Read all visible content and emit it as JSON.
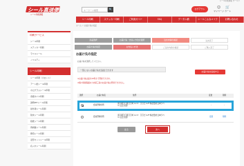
{
  "header": {
    "top_note": "シール印刷通販 ワールド",
    "logo_text": "シール直送便",
    "logo_sub": "シール印刷通販",
    "search_placeholder": "キーワード検索",
    "search_button": "🔍",
    "login_label": "ログアウト",
    "mypage_label": "マイページ",
    "cart_label": "カート"
  },
  "nav": {
    "items": [
      "シール印刷",
      "ステッカー印刷",
      "ご利用ガイド",
      "FAQ",
      "データ入稿",
      "シールこんなメイク",
      "お問い合わせ"
    ]
  },
  "breadcrumb": "ホーム ＞ お届け先の指定",
  "sidebar": {
    "section1_title": "印刷サービス",
    "section1_items": [
      "シール印刷",
      "ステッカー印刷",
      "ラベルシール",
      "ノベルティ"
    ],
    "section2_title": "シール印刷",
    "section2_items": [
      "シール印刷（小ロット）",
      "アート紙シール印刷",
      "ホログラムシール印刷",
      "金銀ホイル印刷",
      "透明PETシール印刷",
      "屋外用シール印刷",
      "耐水シール印刷",
      "和紙シール印刷",
      "再剥離シール印刷",
      "発泡シール印刷",
      "変形カットシール印刷",
      "名入れシール印刷"
    ]
  },
  "steps": {
    "items": [
      "商品選択",
      "お届け先・支払い方法の選択",
      "注文内容の確認",
      "注文完了"
    ],
    "sub_items": [
      "お届け先の指定",
      "お支払い方法",
      "ご注文内容の確認",
      "ご購入完了"
    ]
  },
  "main": {
    "title": "お届け先の指定",
    "description": "お届け先を選択してください。",
    "new_address_placeholder": "一覧にないお届け先を追加できます",
    "add_button": "お届け先を追加する",
    "note1": "※お届け先は最大20件まで登録できます。",
    "note2": "※個人情報保護のため第三者のお届け先は登録できません。",
    "table_headers": [
      "選択",
      "お届け先名",
      "住所",
      "変更",
      "削除"
    ],
    "rows": [
      {
        "name": "会員登録住所",
        "address": "東京都〇〇区〇〇町1-2-3　〇〇ビル2F 株式会社日本ラベル 山田 太郎",
        "edit": "-",
        "delete": "-",
        "selected": true
      },
      {
        "name": "会員登録住所",
        "address": "東京都〇〇区〇〇町1-2-3　〇〇ビル2F 株式会社日本ラベル 山田 太郎",
        "edit": "変更",
        "delete": "削除",
        "selected": false
      }
    ],
    "back_button": "戻る",
    "next_button": "次へ"
  },
  "colors": {
    "brand": "#d32f2f",
    "highlight": "#27a4d9"
  }
}
